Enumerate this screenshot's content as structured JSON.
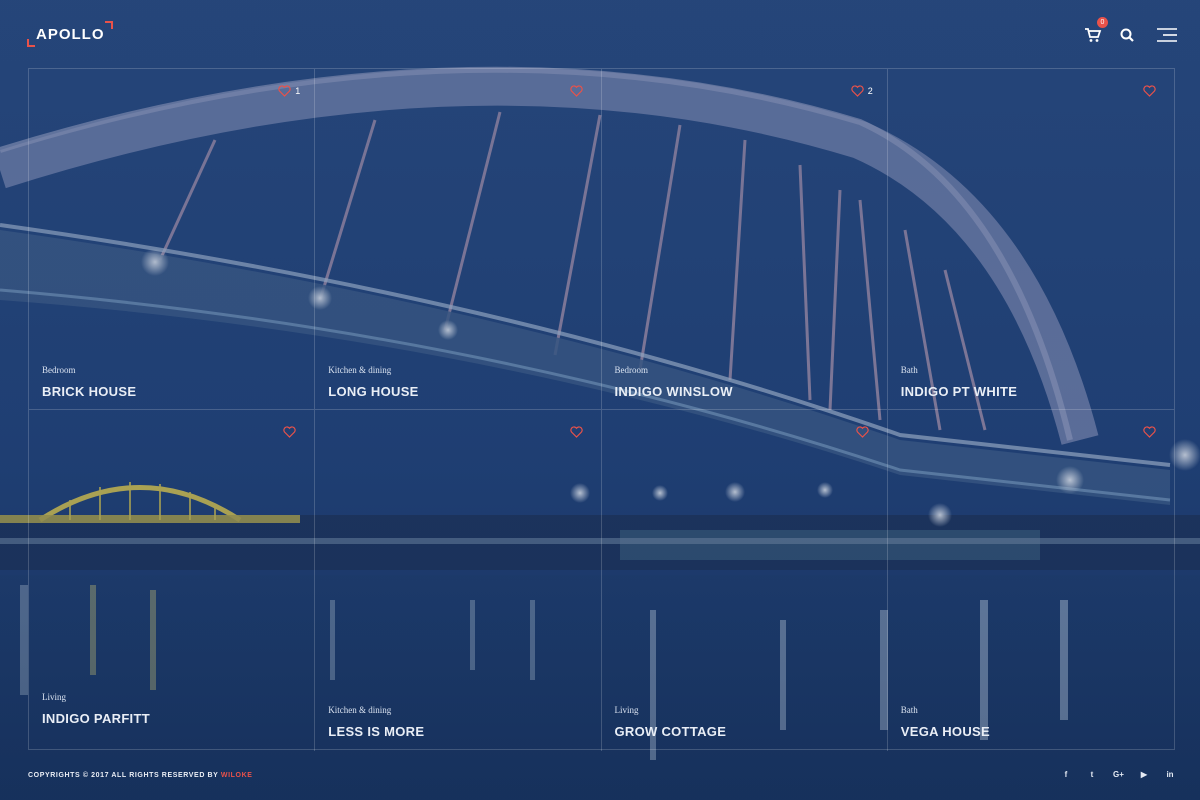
{
  "brand": {
    "logo_text": "APOLLO"
  },
  "header": {
    "cart_count": "0",
    "icons": [
      "cart-icon",
      "search-icon",
      "menu-icon"
    ]
  },
  "colors": {
    "accent": "#e8524a",
    "background": "#1b3563"
  },
  "grid": {
    "items": [
      {
        "category": "Bedroom",
        "title": "BRICK HOUSE",
        "likes": "1"
      },
      {
        "category": "Kitchen & dining",
        "title": "LONG HOUSE",
        "likes": ""
      },
      {
        "category": "Bedroom",
        "title": "INDIGO WINSLOW",
        "likes": "2"
      },
      {
        "category": "Bath",
        "title": "INDIGO PT WHITE",
        "likes": ""
      },
      {
        "category": "Living",
        "title": "INDIGO PARFITT",
        "likes": ""
      },
      {
        "category": "Kitchen & dining",
        "title": "LESS IS MORE",
        "likes": ""
      },
      {
        "category": "Living",
        "title": "GROW COTTAGE",
        "likes": ""
      },
      {
        "category": "Bath",
        "title": "VEGA HOUSE",
        "likes": ""
      }
    ]
  },
  "footer": {
    "copyright": "COPYRIGHTS © 2017 ALL RIGHTS RESERVED BY",
    "brand": "WILOKE",
    "social": [
      {
        "icon": "facebook-icon",
        "glyph": "f"
      },
      {
        "icon": "twitter-icon",
        "glyph": "t"
      },
      {
        "icon": "google-plus-icon",
        "glyph": "G+"
      },
      {
        "icon": "youtube-icon",
        "glyph": "▶"
      },
      {
        "icon": "linkedin-icon",
        "glyph": "in"
      }
    ]
  }
}
